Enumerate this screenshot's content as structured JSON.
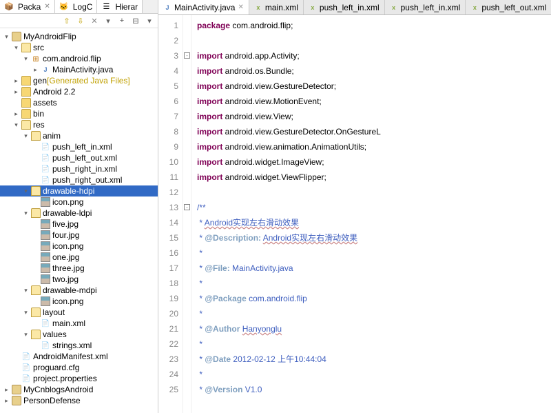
{
  "viewTabs": [
    {
      "label": "Packa",
      "icon": "pkg-icon",
      "close": true
    },
    {
      "label": "LogC",
      "icon": "log-icon",
      "close": false
    },
    {
      "label": "Hierar",
      "icon": "hier-icon",
      "close": false
    }
  ],
  "toolbar": [
    "up",
    "down",
    "x",
    "menu",
    "plus",
    "eq",
    "menu"
  ],
  "tree": [
    {
      "indent": 0,
      "caret": "open",
      "iconClass": "icon-proj",
      "label": "MyAndroidFlip"
    },
    {
      "indent": 1,
      "caret": "open",
      "iconClass": "icon-folder open",
      "label": "src"
    },
    {
      "indent": 2,
      "caret": "open",
      "iconClass": "icon-pkg",
      "label": "com.android.flip"
    },
    {
      "indent": 3,
      "caret": "closed",
      "iconClass": "icon-java",
      "label": "MainActivity.java"
    },
    {
      "indent": 1,
      "caret": "closed",
      "iconClass": "icon-folder",
      "label": "gen",
      "suffix": "[Generated Java Files]",
      "genStyle": true
    },
    {
      "indent": 1,
      "caret": "closed",
      "iconClass": "icon-folder",
      "label": "Android 2.2"
    },
    {
      "indent": 1,
      "caret": "none",
      "iconClass": "icon-folder",
      "label": "assets"
    },
    {
      "indent": 1,
      "caret": "closed",
      "iconClass": "icon-folder",
      "label": "bin"
    },
    {
      "indent": 1,
      "caret": "open",
      "iconClass": "icon-folder open",
      "label": "res"
    },
    {
      "indent": 2,
      "caret": "open",
      "iconClass": "icon-folder open",
      "label": "anim"
    },
    {
      "indent": 3,
      "caret": "none",
      "iconClass": "icon-xml",
      "label": "push_left_in.xml"
    },
    {
      "indent": 3,
      "caret": "none",
      "iconClass": "icon-xml",
      "label": "push_left_out.xml"
    },
    {
      "indent": 3,
      "caret": "none",
      "iconClass": "icon-xml",
      "label": "push_right_in.xml"
    },
    {
      "indent": 3,
      "caret": "none",
      "iconClass": "icon-xml",
      "label": "push_right_out.xml"
    },
    {
      "indent": 2,
      "caret": "open",
      "iconClass": "icon-folder open",
      "label": "drawable-hdpi",
      "selected": true
    },
    {
      "indent": 3,
      "caret": "none",
      "iconClass": "icon-img",
      "label": "icon.png"
    },
    {
      "indent": 2,
      "caret": "open",
      "iconClass": "icon-folder open",
      "label": "drawable-ldpi"
    },
    {
      "indent": 3,
      "caret": "none",
      "iconClass": "icon-img",
      "label": "five.jpg"
    },
    {
      "indent": 3,
      "caret": "none",
      "iconClass": "icon-img",
      "label": "four.jpg"
    },
    {
      "indent": 3,
      "caret": "none",
      "iconClass": "icon-img",
      "label": "icon.png"
    },
    {
      "indent": 3,
      "caret": "none",
      "iconClass": "icon-img",
      "label": "one.jpg"
    },
    {
      "indent": 3,
      "caret": "none",
      "iconClass": "icon-img",
      "label": "three.jpg"
    },
    {
      "indent": 3,
      "caret": "none",
      "iconClass": "icon-img",
      "label": "two.jpg"
    },
    {
      "indent": 2,
      "caret": "open",
      "iconClass": "icon-folder open",
      "label": "drawable-mdpi"
    },
    {
      "indent": 3,
      "caret": "none",
      "iconClass": "icon-img",
      "label": "icon.png"
    },
    {
      "indent": 2,
      "caret": "open",
      "iconClass": "icon-folder open",
      "label": "layout"
    },
    {
      "indent": 3,
      "caret": "none",
      "iconClass": "icon-xml",
      "label": "main.xml"
    },
    {
      "indent": 2,
      "caret": "open",
      "iconClass": "icon-folder open",
      "label": "values"
    },
    {
      "indent": 3,
      "caret": "none",
      "iconClass": "icon-xml",
      "label": "strings.xml"
    },
    {
      "indent": 1,
      "caret": "none",
      "iconClass": "icon-xml",
      "label": "AndroidManifest.xml"
    },
    {
      "indent": 1,
      "caret": "none",
      "iconClass": "icon-file",
      "label": "proguard.cfg"
    },
    {
      "indent": 1,
      "caret": "none",
      "iconClass": "icon-file",
      "label": "project.properties"
    },
    {
      "indent": 0,
      "caret": "closed",
      "iconClass": "icon-proj",
      "label": "MyCnblogsAndroid"
    },
    {
      "indent": 0,
      "caret": "closed",
      "iconClass": "icon-proj",
      "label": "PersonDefense"
    }
  ],
  "editorTabs": [
    {
      "label": "MainActivity.java",
      "iconClass": "java",
      "active": true
    },
    {
      "label": "main.xml",
      "iconClass": "xml"
    },
    {
      "label": "push_left_in.xml",
      "iconClass": "xml"
    },
    {
      "label": "push_left_in.xml",
      "iconClass": "xml"
    },
    {
      "label": "push_left_out.xml",
      "iconClass": "xml"
    }
  ],
  "code": {
    "lines": [
      {
        "n": 1,
        "html": "<span class='kw'>package</span> com.android.flip;"
      },
      {
        "n": 2,
        "html": ""
      },
      {
        "n": 3,
        "html": "<span class='kw'>import</span> android.app.Activity;",
        "fold": "-"
      },
      {
        "n": 4,
        "html": "<span class='kw'>import</span> android.os.Bundle;"
      },
      {
        "n": 5,
        "html": "<span class='kw'>import</span> android.view.GestureDetector;"
      },
      {
        "n": 6,
        "html": "<span class='kw'>import</span> android.view.MotionEvent;"
      },
      {
        "n": 7,
        "html": "<span class='kw'>import</span> android.view.View;"
      },
      {
        "n": 8,
        "html": "<span class='kw'>import</span> android.view.GestureDetector.OnGestureL"
      },
      {
        "n": 9,
        "html": "<span class='kw'>import</span> android.view.animation.AnimationUtils;"
      },
      {
        "n": 10,
        "html": "<span class='kw'>import</span> android.widget.ImageView;"
      },
      {
        "n": 11,
        "html": "<span class='kw'>import</span> android.widget.ViewFlipper;"
      },
      {
        "n": 12,
        "html": ""
      },
      {
        "n": 13,
        "html": "<span class='comment-doc'>/**</span>",
        "fold": "-"
      },
      {
        "n": 14,
        "html": "<span class='comment-doc'> * <span class='underline'>Android实现左右滑动效果</span></span>"
      },
      {
        "n": 15,
        "html": "<span class='comment-doc'> * <span class='tag'>@Description:</span> <span class='underline'>Android实现左右滑动效果</span></span>"
      },
      {
        "n": 16,
        "html": "<span class='comment-doc'> *</span>"
      },
      {
        "n": 17,
        "html": "<span class='comment-doc'> * <span class='tag'>@File:</span> MainActivity.java</span>"
      },
      {
        "n": 18,
        "html": "<span class='comment-doc'> *</span>"
      },
      {
        "n": 19,
        "html": "<span class='comment-doc'> * <span class='tag'>@Package</span> com.android.flip</span>"
      },
      {
        "n": 20,
        "html": "<span class='comment-doc'> *</span>"
      },
      {
        "n": 21,
        "html": "<span class='comment-doc'> * <span class='tag'>@Author</span> <span class='underline'>Hanyonglu</span></span>"
      },
      {
        "n": 22,
        "html": "<span class='comment-doc'> *</span>"
      },
      {
        "n": 23,
        "html": "<span class='comment-doc'> * <span class='tag'>@Date</span> 2012-02-12 上午10:44:04</span>"
      },
      {
        "n": 24,
        "html": "<span class='comment-doc'> *</span>"
      },
      {
        "n": 25,
        "html": "<span class='comment-doc'> * <span class='tag'>@Version</span> V1.0</span>"
      }
    ]
  }
}
